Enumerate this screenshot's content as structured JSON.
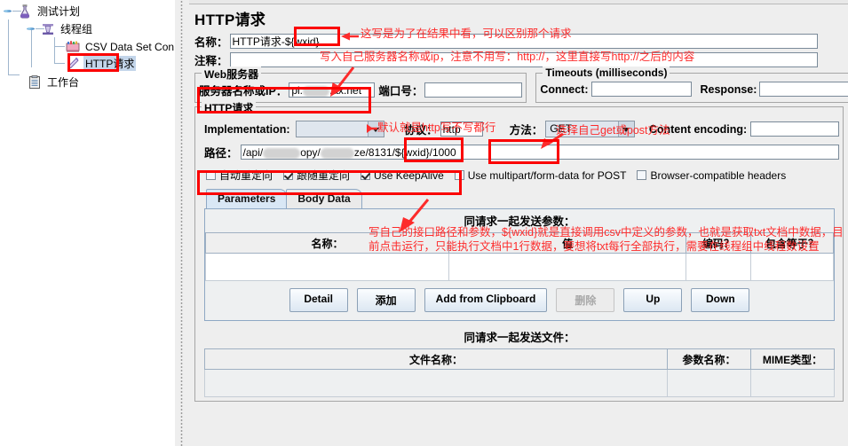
{
  "sidebar": {
    "items": [
      {
        "label": "测试计划",
        "icon": "flask-icon",
        "depth": 0,
        "selected": false
      },
      {
        "label": "线程组",
        "icon": "thread-group-icon",
        "depth": 1,
        "selected": false
      },
      {
        "label": "CSV Data Set Config",
        "icon": "csv-config-icon",
        "depth": 2,
        "selected": false
      },
      {
        "label": "HTTP请求",
        "icon": "http-request-icon",
        "depth": 2,
        "selected": true
      },
      {
        "label": "工作台",
        "icon": "workbench-icon",
        "depth": 0,
        "selected": false
      }
    ]
  },
  "main": {
    "title": "HTTP请求",
    "name_label": "名称：",
    "name_value": "HTTP请求-${wxid}",
    "comment_label": "注释：",
    "comment_value": "",
    "webserver": {
      "group_title": "Web服务器",
      "server_label": "服务器名称或IP：",
      "server_value_prefix": "pi.",
      "server_value_suffix": ".ax.net",
      "port_label": "端口号：",
      "port_value": ""
    },
    "timeouts": {
      "group_title": "Timeouts (milliseconds)",
      "connect_label": "Connect:",
      "connect_value": "",
      "response_label": "Response:",
      "response_value": ""
    },
    "httprequest": {
      "group_title": "HTTP请求",
      "implementation_label": "Implementation:",
      "implementation_value": "",
      "protocol_label": "协议：",
      "protocol_value": "http",
      "method_label": "方法：",
      "method_value": "GET",
      "content_encoding_label": "Content encoding:",
      "content_encoding_value": "",
      "path_label": "路径：",
      "path_part1": "/api/",
      "path_part2": "opy/",
      "path_part3": "ze/8131/${wxid}/1000"
    },
    "checkboxes": [
      {
        "label": "自动重定向",
        "checked": false
      },
      {
        "label": "跟随重定向",
        "checked": true
      },
      {
        "label": "Use KeepAlive",
        "checked": true
      },
      {
        "label": "Use multipart/form-data for POST",
        "checked": false
      },
      {
        "label": "Browser-compatible headers",
        "checked": false
      }
    ],
    "tabs": [
      {
        "label": "Parameters",
        "selected": true
      },
      {
        "label": "Body Data",
        "selected": false
      }
    ],
    "params_section": {
      "title": "同请求一起发送参数：",
      "columns": [
        "名称：",
        "值",
        "编码？",
        "包含等于？"
      ],
      "rows": []
    },
    "buttons": [
      {
        "label": "Detail",
        "enabled": true
      },
      {
        "label": "添加",
        "enabled": true
      },
      {
        "label": "Add from Clipboard",
        "enabled": true
      },
      {
        "label": "删除",
        "enabled": false
      },
      {
        "label": "Up",
        "enabled": true
      },
      {
        "label": "Down",
        "enabled": true
      }
    ],
    "files_section": {
      "title": "同请求一起发送文件：",
      "columns": [
        "文件名称：",
        "参数名称：",
        "MIME类型："
      ]
    }
  },
  "annotations": {
    "color": "#fd2b2b",
    "name_note": "这写是为了在结果中看，可以区别那个请求",
    "server_note": "写入自己服务器名称或ip，注意不用写：http://，这里直接写http://之后的内容",
    "protocol_note": "默认就是http写不写都行",
    "method_note": "选择自己get或post方法",
    "path_note": "写自己的接口路径和参数，${wxid}就是直接调用csv中定义的参数，也就是获取txt文档中数据，目前点击运行，只能执行文档中1行数据，要想将txt每行全部执行，需要在线程组中线程数设置"
  }
}
